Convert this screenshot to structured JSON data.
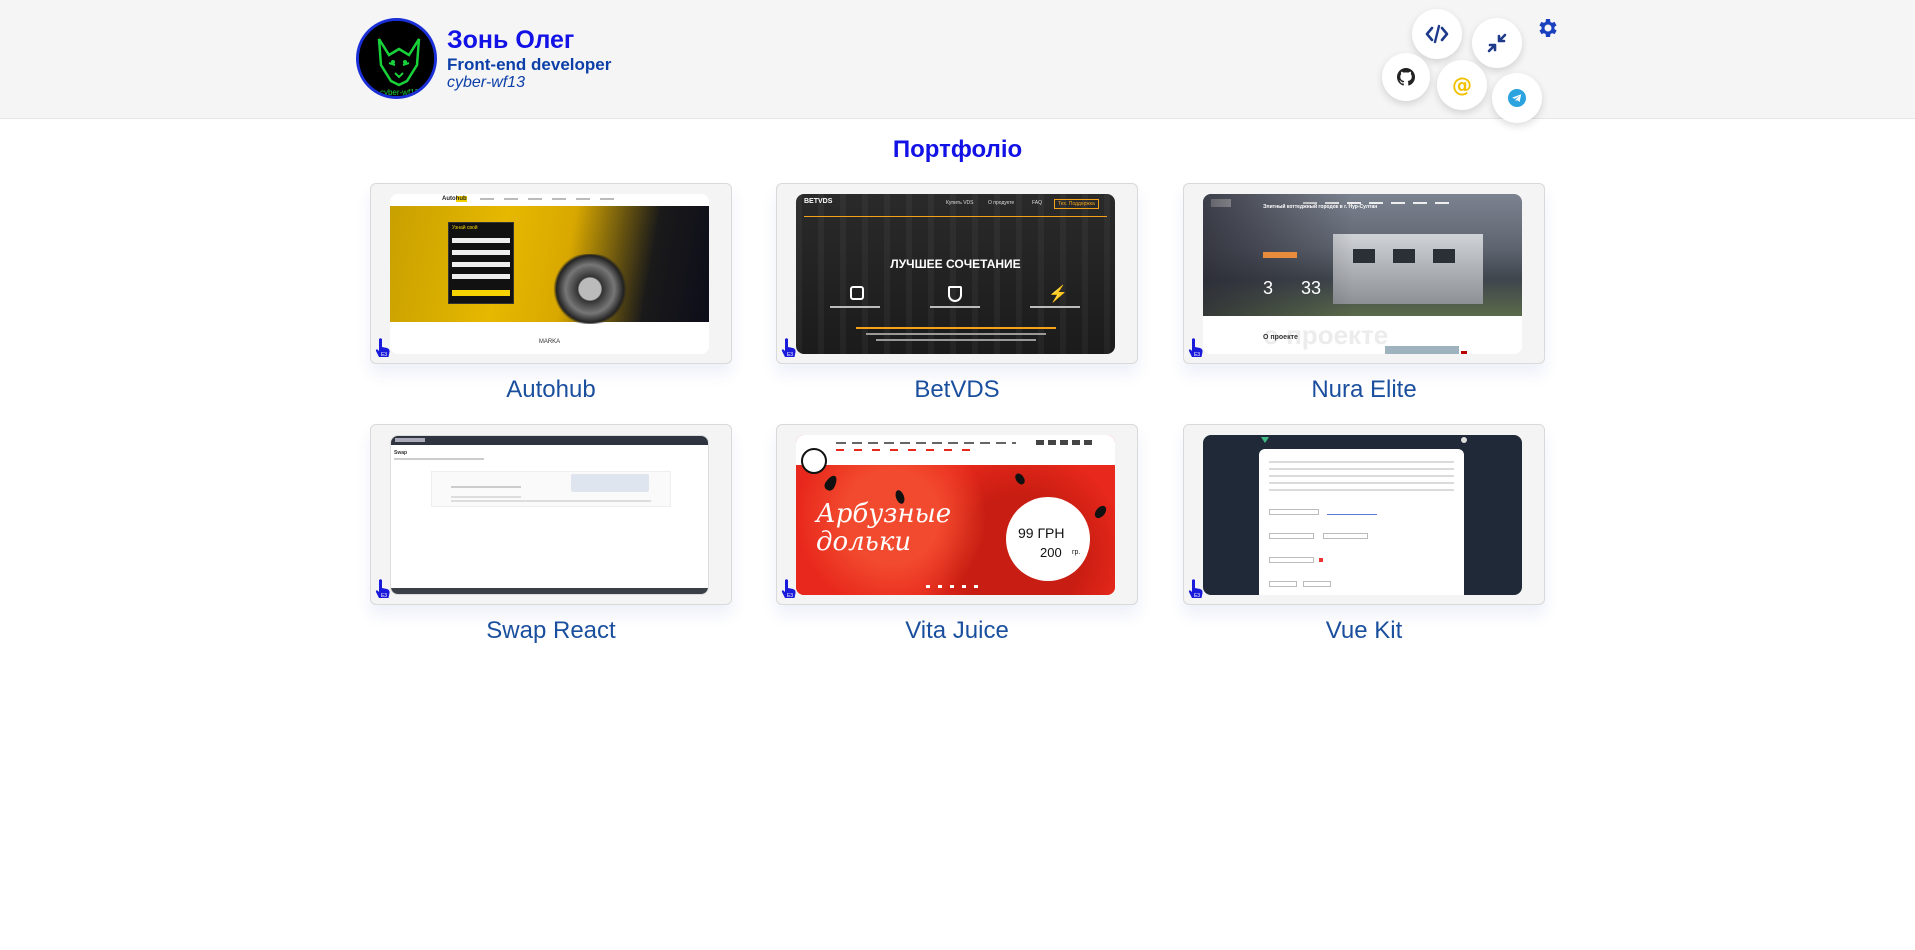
{
  "header": {
    "name": "Зонь Олег",
    "role": "Front-end developer",
    "nick": "cyber-wf13",
    "avatar_caption": "cyber-wf13"
  },
  "icons": {
    "code": "code-icon",
    "collapse": "compress-arrows-icon",
    "github": "github-icon",
    "email": "at-sign-icon",
    "telegram": "telegram-icon",
    "settings": "gear-icon"
  },
  "colors": {
    "accent": "#1212e6",
    "label": "#1a4f9e",
    "header_bg": "#f5f5f5"
  },
  "section_title": "Портфоліо",
  "projects": [
    {
      "label": "Autohub"
    },
    {
      "label": "BetVDS"
    },
    {
      "label": "Nura Elite"
    },
    {
      "label": "Swap React"
    },
    {
      "label": "Vita Juice"
    },
    {
      "label": "Vue Kit"
    }
  ],
  "previews": {
    "autohub": {
      "logo": "Auto",
      "logo_accent": "hub",
      "form_title": "Узнай свой",
      "footer": "MARKA"
    },
    "betvds": {
      "logo": "BETVDS",
      "nav1": "Купить VDS",
      "nav2": "О продукте",
      "nav3": "FAQ",
      "nav4": "Тех. Поддержка",
      "headline": "ЛУЧШЕЕ СОЧЕТАНИЕ"
    },
    "nura": {
      "headline": "Элитный коттеджный городок в г. Нур-Султан",
      "stat1": "3",
      "stat2": "33",
      "about": "О проекте",
      "about_bg": "о проекте"
    },
    "swap": {
      "title": "Swap"
    },
    "vita": {
      "line1": "Арбузные",
      "line2": "дольки",
      "price": "99 ГРН",
      "weight": "200",
      "unit": "гр."
    }
  }
}
